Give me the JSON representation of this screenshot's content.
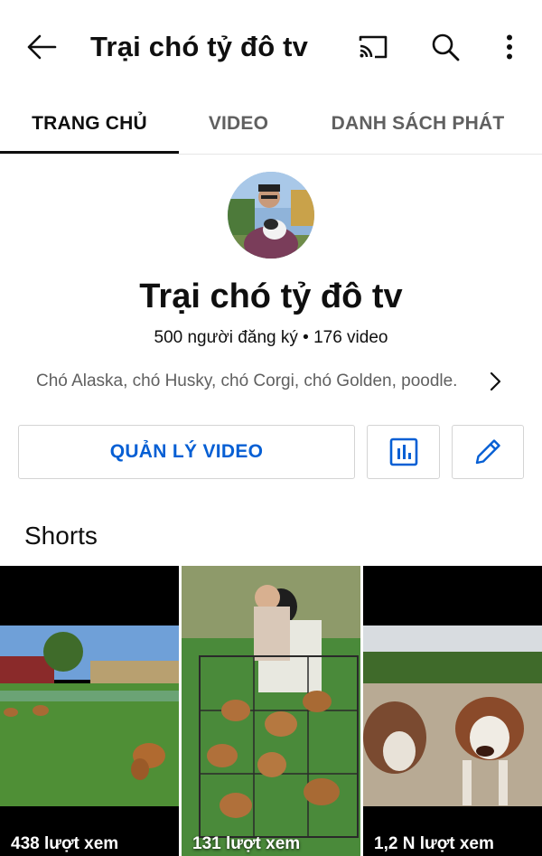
{
  "appbar": {
    "title": "Trại chó tỷ đô tv",
    "icons": [
      "back-arrow-icon",
      "cast-icon",
      "search-icon",
      "more-vert-icon"
    ]
  },
  "tabs": [
    {
      "label": "TRANG CHỦ",
      "active": true
    },
    {
      "label": "VIDEO",
      "active": false
    },
    {
      "label": "DANH SÁCH PHÁT",
      "active": false
    }
  ],
  "channel": {
    "name": "Trại chó tỷ đô tv",
    "stats": "500 người đăng ký • 176 video",
    "description": "Chó Alaska, chó Husky, chó Corgi, chó Golden, poodle."
  },
  "actions": {
    "manage_label": "QUẢN LÝ VIDEO",
    "analytics_icon": "bar-chart-icon",
    "edit_icon": "pencil-icon"
  },
  "shorts": {
    "title": "Shorts",
    "items": [
      {
        "views": "438 lượt xem"
      },
      {
        "views": "131 lượt xem"
      },
      {
        "views": "1,2 N lượt xem"
      }
    ]
  },
  "colors": {
    "accent_blue": "#065fd4",
    "text_primary": "#0f0f0f",
    "text_secondary": "#606060",
    "border": "#d4d4d4"
  }
}
